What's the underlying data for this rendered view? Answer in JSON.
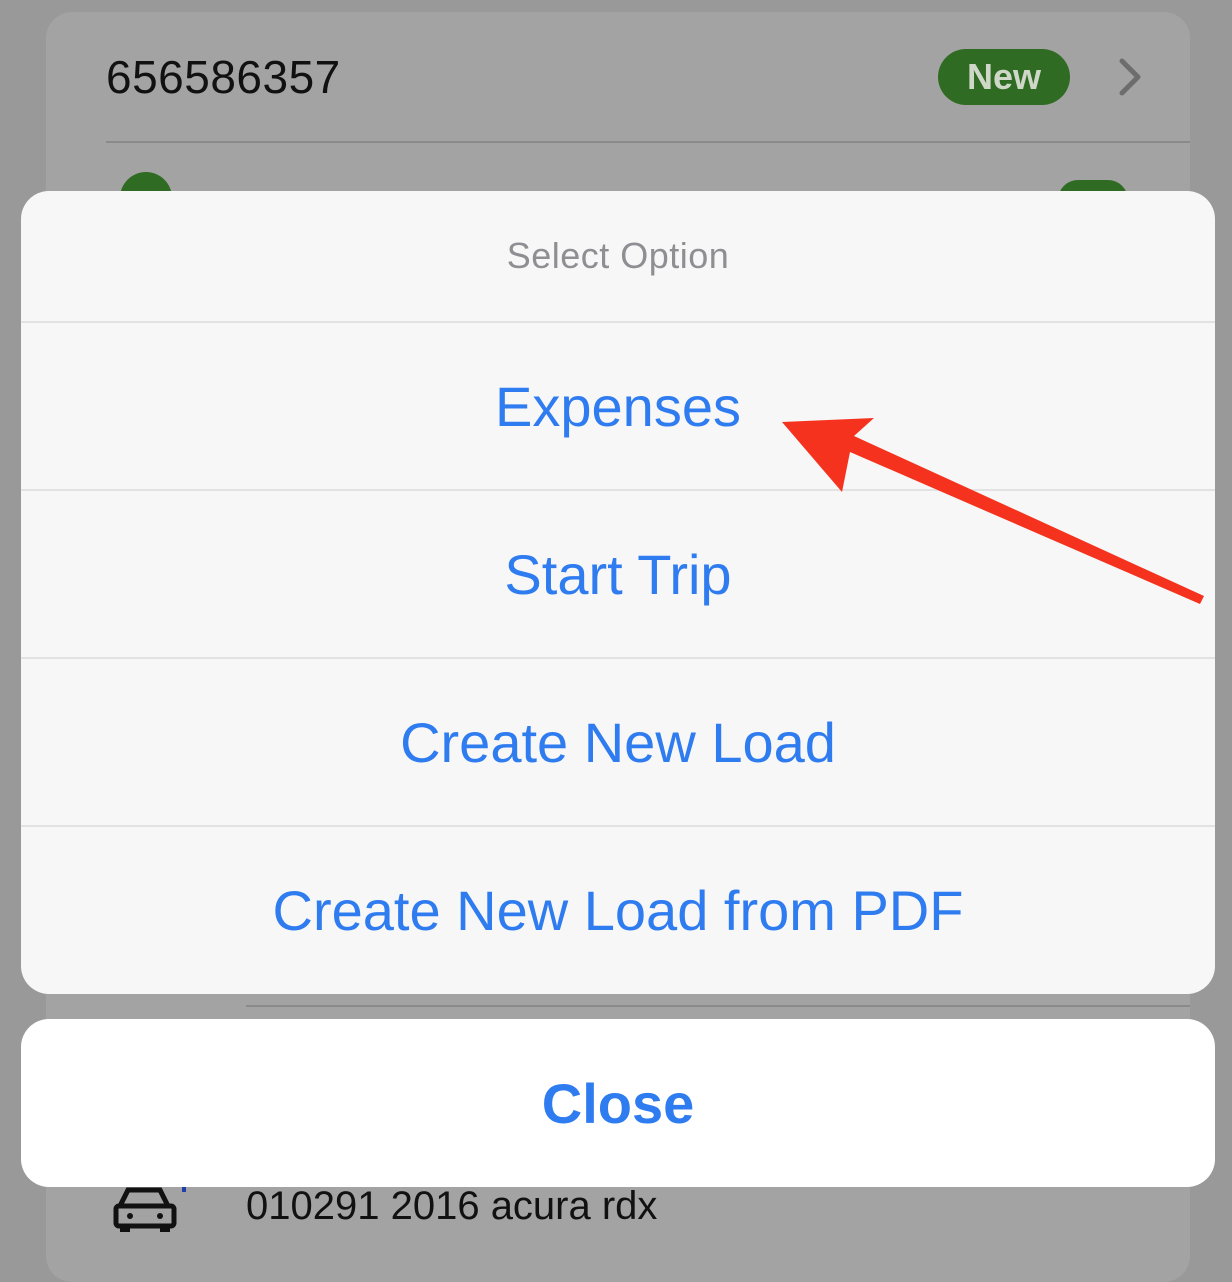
{
  "background": {
    "load_number": "656586357",
    "status_badge": "New",
    "vehicle_label": "010291 2016 acura rdx",
    "icons": [
      "chevron-right-icon",
      "car-icon"
    ]
  },
  "action_sheet": {
    "title": "Select Option",
    "options": [
      {
        "label": "Expenses"
      },
      {
        "label": "Start Trip"
      },
      {
        "label": "Create New Load"
      },
      {
        "label": "Create New Load from PDF"
      }
    ],
    "close_label": "Close"
  },
  "colors": {
    "accent": "#2f7cf0",
    "badge_green": "#2f6b22",
    "annotation_red": "#f5321e"
  }
}
